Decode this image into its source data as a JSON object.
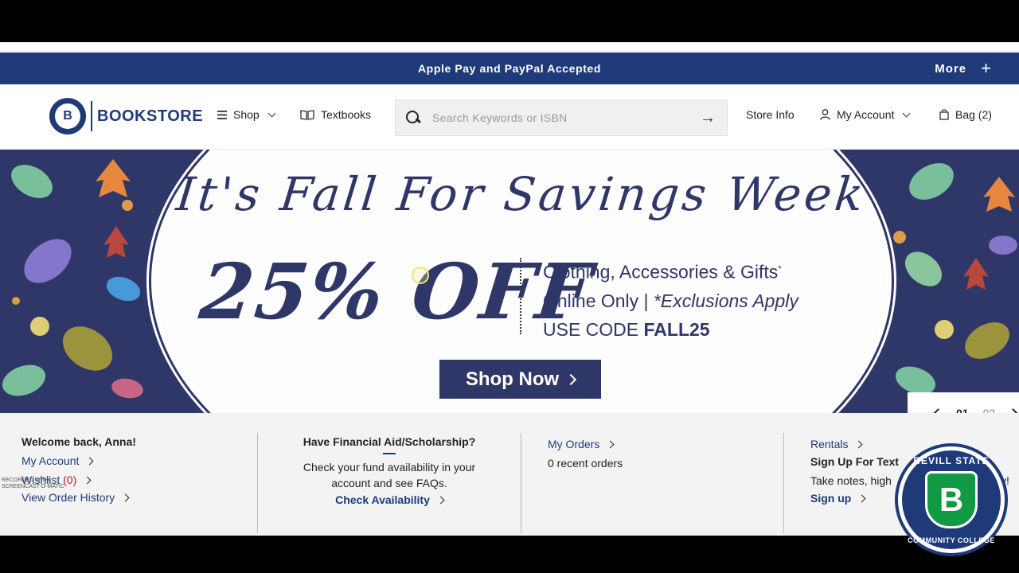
{
  "promo": {
    "text": "Apple Pay and PayPal Accepted",
    "more_label": "More",
    "plus": "+"
  },
  "header": {
    "logo_text": "BOOKSTORE",
    "logo_glyph": "B",
    "nav": {
      "shop": "Shop",
      "textbooks": "Textbooks",
      "store_info": "Store Info",
      "my_account": "My Account",
      "bag": "Bag (2)"
    },
    "search": {
      "placeholder": "Search Keywords or ISBN",
      "arrow": "→"
    }
  },
  "hero": {
    "title": "It's Fall For Savings Week",
    "discount": "25% OFF",
    "line1": "Clothing, Accessories & Gifts",
    "line1_sup": "*",
    "line2_a": "Online Only | ",
    "line2_b": "*Exclusions Apply",
    "line3_a": "USE CODE ",
    "line3_code": "FALL25",
    "cta": "Shop Now"
  },
  "slider": {
    "current": "01",
    "next": "02"
  },
  "info": {
    "welcome": "Welcome back, Anna!",
    "my_account": "My Account",
    "wishlist": "Wishlist",
    "wishlist_count": "(0)",
    "order_history": "View Order History",
    "aid_title": "Have Financial Aid/Scholarship?",
    "aid_text1": "Check your fund availability in your",
    "aid_text2": "account and see FAQs.",
    "aid_link": "Check Availability",
    "orders_link": "My Orders",
    "orders_count": "0 recent orders",
    "rentals": "Rentals",
    "signup_title": "Sign Up For Text",
    "signup_text": "Take notes, high",
    "signup_text_end": "y!",
    "signup_link": "Sign up"
  },
  "watermark": {
    "line1": "RECORDED WITH",
    "line2": "SCREENCAST-O-MATIC"
  },
  "seal": {
    "top": "BEVILL STATE",
    "bottom": "COMMUNITY COLLEGE",
    "glyph": "B"
  },
  "colors": {
    "navy": "#1e3a78",
    "hero_navy": "#2f3668",
    "green": "#0f9a43",
    "red": "#c0181f"
  }
}
